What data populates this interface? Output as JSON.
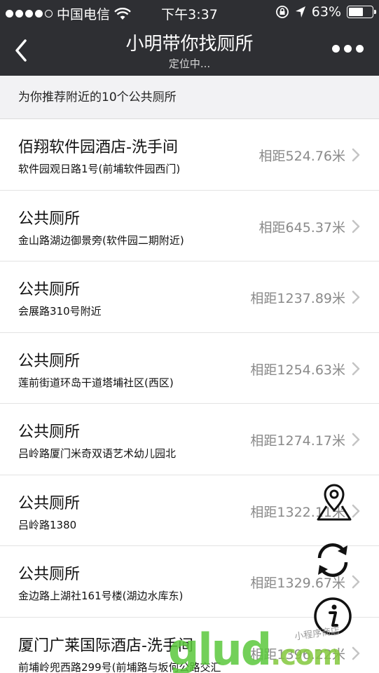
{
  "status_bar": {
    "carrier": "中国电信",
    "time": "下午3:37",
    "battery_text": "63%",
    "battery_level": 0.63,
    "signal_bars_filled": 4,
    "signal_bars_total": 5
  },
  "nav": {
    "title": "小明带你找厕所",
    "subtitle": "定位中..."
  },
  "header": {
    "text": "为你推荐附近的10个公共厕所"
  },
  "toilets": [
    {
      "name": "佰翔软件园酒店-洗手间",
      "address": "软件园观日路1号(前埔软件园西门)",
      "distance": "相距524.76米"
    },
    {
      "name": "公共厕所",
      "address": "金山路湖边御景旁(软件园二期附近)",
      "distance": "相距645.37米"
    },
    {
      "name": "公共厕所",
      "address": "会展路310号附近",
      "distance": "相距1237.89米"
    },
    {
      "name": "公共厕所",
      "address": "莲前街道环岛干道塔埔社区(西区)",
      "distance": "相距1254.63米"
    },
    {
      "name": "公共厕所",
      "address": "吕岭路厦门米奇双语艺术幼儿园北",
      "distance": "相距1274.17米"
    },
    {
      "name": "公共厕所",
      "address": "吕岭路1380",
      "distance": "相距1322.11米"
    },
    {
      "name": "公共厕所",
      "address": "金边路上湖社161号楼(湖边水库东)",
      "distance": "相距1329.67米"
    },
    {
      "name": "厦门广莱国际酒店-洗手间",
      "address": "前埔岭兜西路299号(前埔路与坂何公路交汇",
      "distance": "相距1396.22米"
    }
  ],
  "watermark": {
    "main": "glud",
    "suffix": ".com",
    "small": "小程序商店"
  },
  "icons": {
    "back": "chevron-left-icon",
    "more": "more-dots-icon",
    "location": "map-pin-icon",
    "refresh": "refresh-icon",
    "info": "info-icon",
    "chevron": "chevron-right-icon"
  }
}
